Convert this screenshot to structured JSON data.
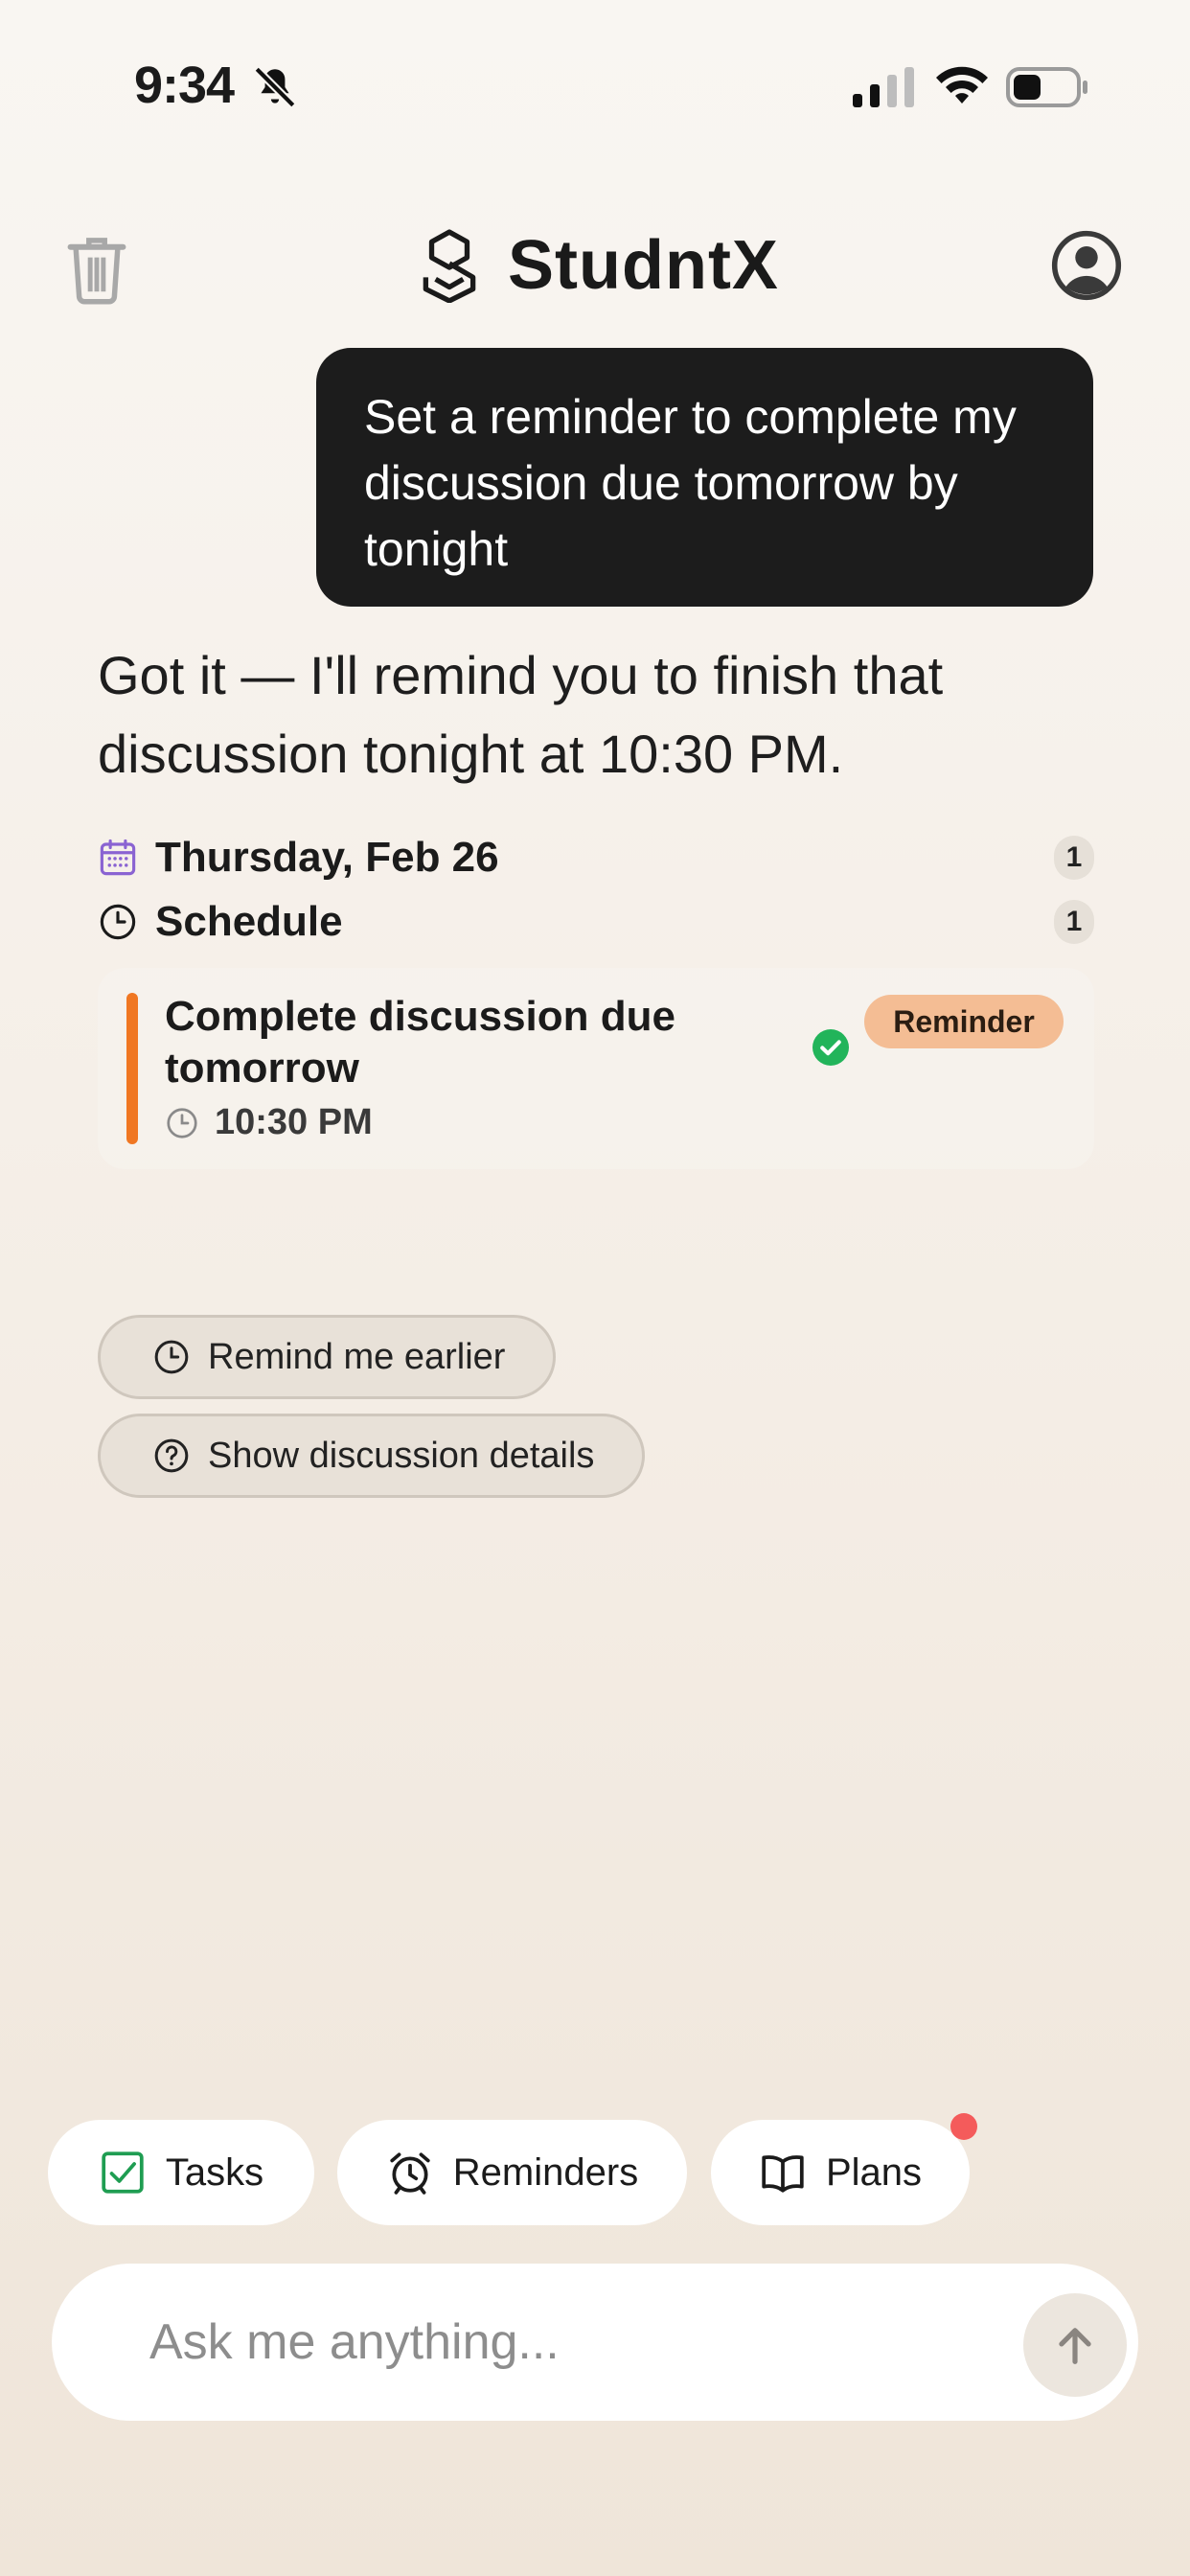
{
  "status_bar": {
    "time": "9:34",
    "icons": [
      "bell-slash-icon",
      "cellular-signal-icon",
      "wifi-icon",
      "battery-icon"
    ]
  },
  "header": {
    "app_name": "StudntX",
    "icons": [
      "trash-icon",
      "logo-icon",
      "profile-icon"
    ]
  },
  "chat": {
    "user_message": "Set a reminder to complete my discussion due tomorrow by tonight",
    "assistant_message": "Got it — I'll remind you to finish that discussion tonight at 10:30 PM."
  },
  "schedule": {
    "date_label": "Thursday, Feb 26",
    "date_count": "1",
    "section_label": "Schedule",
    "section_count": "1",
    "event": {
      "title": "Complete discussion due tomorrow",
      "time": "10:30 PM",
      "tag": "Reminder",
      "accent_color": "#f07722",
      "status": "check-circle-icon"
    }
  },
  "suggestions": [
    {
      "label": "Remind me earlier",
      "icon": "clock-icon"
    },
    {
      "label": "Show discussion details",
      "icon": "question-circle-icon"
    }
  ],
  "quick_actions": [
    {
      "label": "Tasks",
      "icon": "checkbox-icon"
    },
    {
      "label": "Reminders",
      "icon": "alarm-clock-icon"
    },
    {
      "label": "Plans",
      "icon": "book-icon"
    }
  ],
  "composer": {
    "placeholder": "Ask me anything...",
    "send_icon": "arrow-up-icon"
  }
}
